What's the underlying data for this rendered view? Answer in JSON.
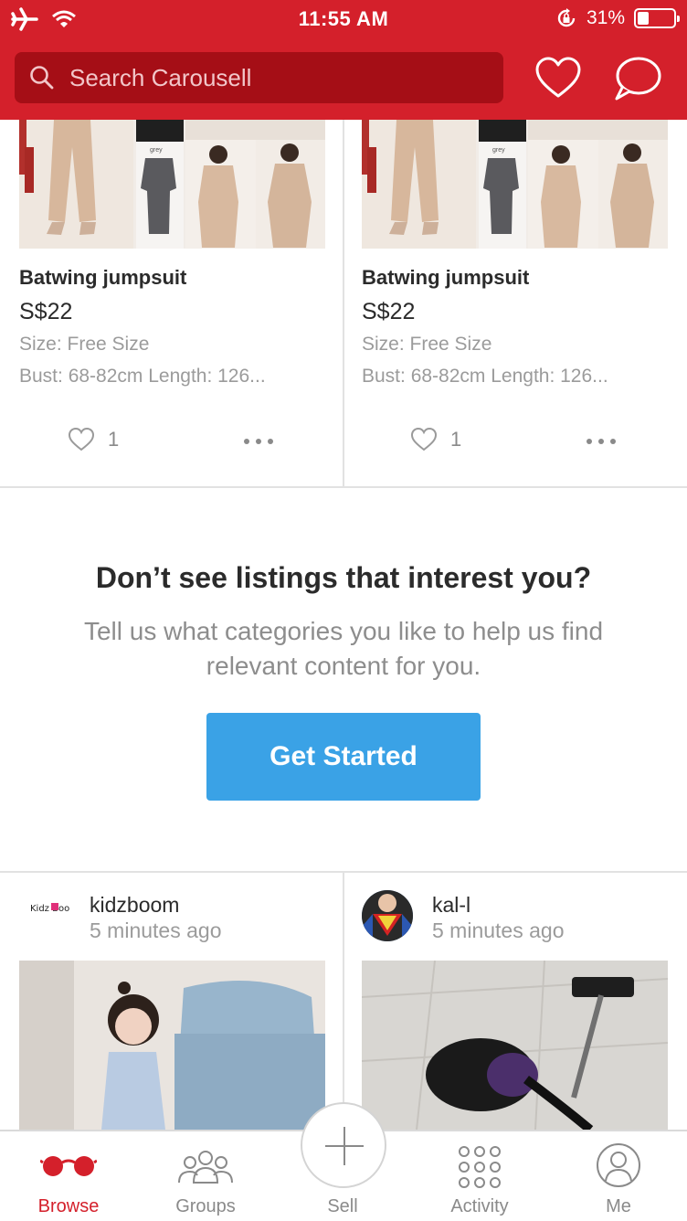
{
  "status_bar": {
    "time": "11:55 AM",
    "battery": "31%"
  },
  "search": {
    "placeholder": "Search Carousell"
  },
  "listings": [
    {
      "title": "Batwing jumpsuit",
      "price": "S$22",
      "size": "Size: Free Size",
      "details": "Bust: 68-82cm Length: 126...",
      "likes": "1",
      "photo_label": "grey"
    },
    {
      "title": "Batwing jumpsuit",
      "price": "S$22",
      "size": "Size: Free Size",
      "details": "Bust: 68-82cm Length: 126...",
      "likes": "1",
      "photo_label": "grey"
    }
  ],
  "prompt": {
    "title": "Don’t see listings that interest you?",
    "subtitle": "Tell us what categories you like to help us find relevant content for you.",
    "button": "Get Started"
  },
  "feed": [
    {
      "seller": "kidzboom",
      "time": "5 minutes ago",
      "avatar_text": "Kidz Boom"
    },
    {
      "seller": "kal-l",
      "time": "5 minutes ago"
    }
  ],
  "tabs": {
    "browse": "Browse",
    "groups": "Groups",
    "sell": "Sell",
    "activity": "Activity",
    "me": "Me"
  },
  "colors": {
    "brand_red": "#d4202b",
    "search_bg": "#a50e16",
    "cta_blue": "#3aa2e6",
    "active_tab": "#d4202b"
  }
}
